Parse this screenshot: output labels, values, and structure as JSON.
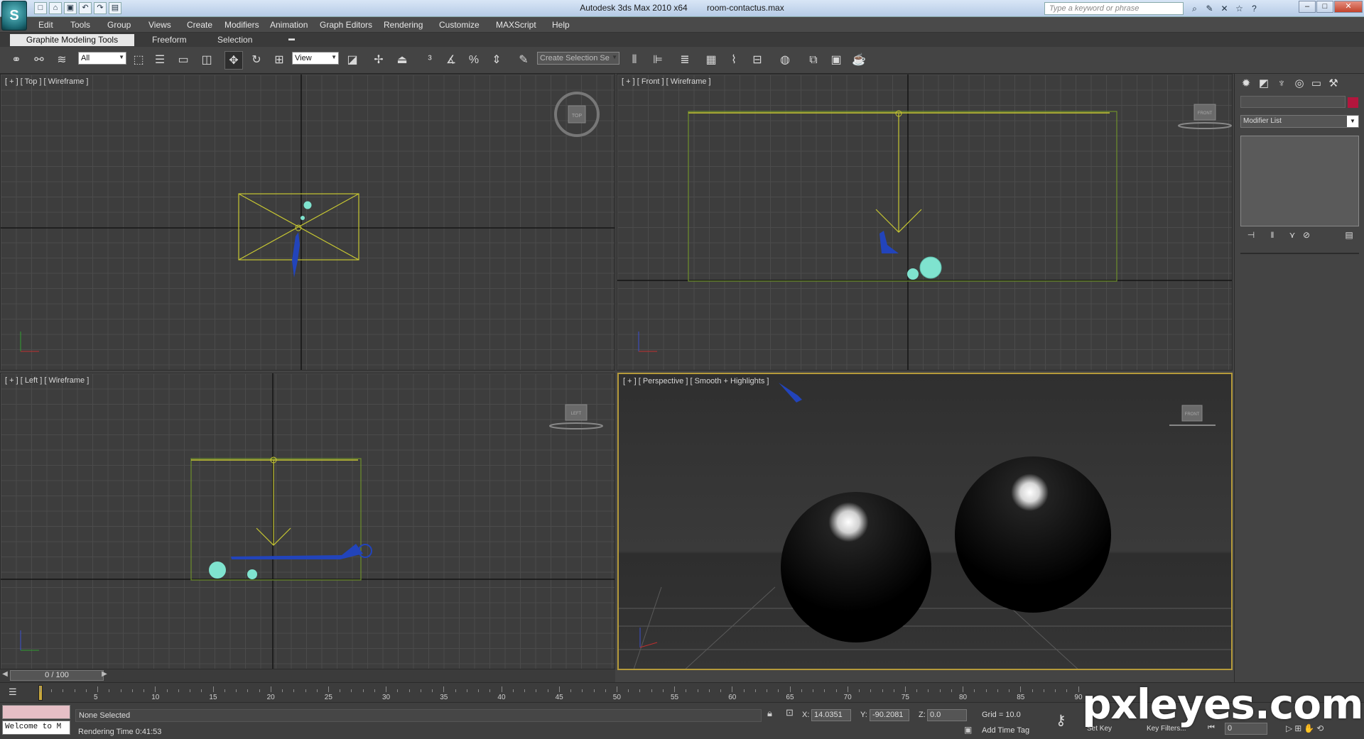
{
  "window": {
    "app_title": "Autodesk 3ds Max 2010 x64",
    "file_name": "room-contactus.max",
    "search_placeholder": "Type a keyword or phrase",
    "logo_letter": "S"
  },
  "menu": [
    "Edit",
    "Tools",
    "Group",
    "Views",
    "Create",
    "Modifiers",
    "Animation",
    "Graph Editors",
    "Rendering",
    "Customize",
    "MAXScript",
    "Help"
  ],
  "ribbon": {
    "tabs": [
      "Graphite Modeling Tools",
      "Freeform",
      "Selection"
    ],
    "active_tab": "Graphite Modeling Tools"
  },
  "toolbar": {
    "selection_filter": "All",
    "ref_coord": "View",
    "named_selection": "Create Selection Se"
  },
  "viewports": {
    "top": {
      "label": "[ + ] [ Top ] [ Wireframe ]",
      "cube_label": "TOP"
    },
    "front": {
      "label": "[ + ] [ Front ] [ Wireframe ]",
      "cube_label": "FRONT"
    },
    "left": {
      "label": "[ + ] [ Left ] [ Wireframe ]",
      "cube_label": "LEFT"
    },
    "perspective": {
      "label": "[ + ] [ Perspective ] [ Smooth + Highlights ]",
      "cube_label": "FRONT"
    }
  },
  "command_panel": {
    "modifier_list": "Modifier List",
    "object_color": "#b3163d"
  },
  "timeline": {
    "frame_display": "0 / 100",
    "ticks": [
      "5",
      "10",
      "15",
      "20",
      "25",
      "30",
      "35",
      "40",
      "45",
      "50",
      "55",
      "60",
      "65",
      "70",
      "75",
      "80",
      "85",
      "90"
    ]
  },
  "status": {
    "selection": "None Selected",
    "render_time": "Rendering Time  0:41:53",
    "x_label": "X:",
    "x": "14.0351",
    "y_label": "Y:",
    "y": "-90.2081",
    "z_label": "Z:",
    "z": "0.0",
    "grid": "Grid = 10.0",
    "add_time_tag": "Add Time Tag",
    "set_key": "Set Key",
    "key_filters": "Key Filters...",
    "frame_field": "0",
    "listener_text": "Welcome to M"
  },
  "watermark": "pxleyes.com",
  "colors": {
    "selection_yellow": "#c8c832",
    "light_cyan": "#7fe3cf",
    "camera_blue": "#2244bb",
    "viewport_bg": "#3d3d3d"
  }
}
